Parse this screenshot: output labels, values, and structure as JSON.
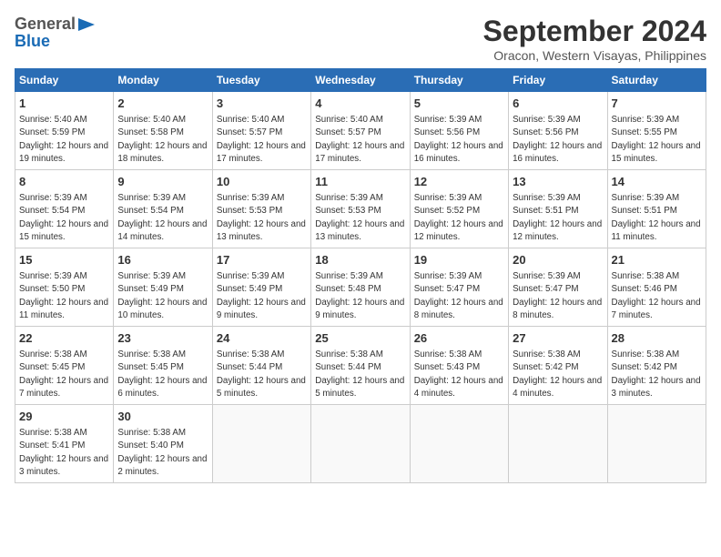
{
  "header": {
    "logo_general": "General",
    "logo_blue": "Blue",
    "month_title": "September 2024",
    "location": "Oracon, Western Visayas, Philippines"
  },
  "days_of_week": [
    "Sunday",
    "Monday",
    "Tuesday",
    "Wednesday",
    "Thursday",
    "Friday",
    "Saturday"
  ],
  "weeks": [
    [
      {
        "day": "1",
        "sunrise": "Sunrise: 5:40 AM",
        "sunset": "Sunset: 5:59 PM",
        "daylight": "Daylight: 12 hours and 19 minutes."
      },
      {
        "day": "2",
        "sunrise": "Sunrise: 5:40 AM",
        "sunset": "Sunset: 5:58 PM",
        "daylight": "Daylight: 12 hours and 18 minutes."
      },
      {
        "day": "3",
        "sunrise": "Sunrise: 5:40 AM",
        "sunset": "Sunset: 5:57 PM",
        "daylight": "Daylight: 12 hours and 17 minutes."
      },
      {
        "day": "4",
        "sunrise": "Sunrise: 5:40 AM",
        "sunset": "Sunset: 5:57 PM",
        "daylight": "Daylight: 12 hours and 17 minutes."
      },
      {
        "day": "5",
        "sunrise": "Sunrise: 5:39 AM",
        "sunset": "Sunset: 5:56 PM",
        "daylight": "Daylight: 12 hours and 16 minutes."
      },
      {
        "day": "6",
        "sunrise": "Sunrise: 5:39 AM",
        "sunset": "Sunset: 5:56 PM",
        "daylight": "Daylight: 12 hours and 16 minutes."
      },
      {
        "day": "7",
        "sunrise": "Sunrise: 5:39 AM",
        "sunset": "Sunset: 5:55 PM",
        "daylight": "Daylight: 12 hours and 15 minutes."
      }
    ],
    [
      {
        "day": "8",
        "sunrise": "Sunrise: 5:39 AM",
        "sunset": "Sunset: 5:54 PM",
        "daylight": "Daylight: 12 hours and 15 minutes."
      },
      {
        "day": "9",
        "sunrise": "Sunrise: 5:39 AM",
        "sunset": "Sunset: 5:54 PM",
        "daylight": "Daylight: 12 hours and 14 minutes."
      },
      {
        "day": "10",
        "sunrise": "Sunrise: 5:39 AM",
        "sunset": "Sunset: 5:53 PM",
        "daylight": "Daylight: 12 hours and 13 minutes."
      },
      {
        "day": "11",
        "sunrise": "Sunrise: 5:39 AM",
        "sunset": "Sunset: 5:53 PM",
        "daylight": "Daylight: 12 hours and 13 minutes."
      },
      {
        "day": "12",
        "sunrise": "Sunrise: 5:39 AM",
        "sunset": "Sunset: 5:52 PM",
        "daylight": "Daylight: 12 hours and 12 minutes."
      },
      {
        "day": "13",
        "sunrise": "Sunrise: 5:39 AM",
        "sunset": "Sunset: 5:51 PM",
        "daylight": "Daylight: 12 hours and 12 minutes."
      },
      {
        "day": "14",
        "sunrise": "Sunrise: 5:39 AM",
        "sunset": "Sunset: 5:51 PM",
        "daylight": "Daylight: 12 hours and 11 minutes."
      }
    ],
    [
      {
        "day": "15",
        "sunrise": "Sunrise: 5:39 AM",
        "sunset": "Sunset: 5:50 PM",
        "daylight": "Daylight: 12 hours and 11 minutes."
      },
      {
        "day": "16",
        "sunrise": "Sunrise: 5:39 AM",
        "sunset": "Sunset: 5:49 PM",
        "daylight": "Daylight: 12 hours and 10 minutes."
      },
      {
        "day": "17",
        "sunrise": "Sunrise: 5:39 AM",
        "sunset": "Sunset: 5:49 PM",
        "daylight": "Daylight: 12 hours and 9 minutes."
      },
      {
        "day": "18",
        "sunrise": "Sunrise: 5:39 AM",
        "sunset": "Sunset: 5:48 PM",
        "daylight": "Daylight: 12 hours and 9 minutes."
      },
      {
        "day": "19",
        "sunrise": "Sunrise: 5:39 AM",
        "sunset": "Sunset: 5:47 PM",
        "daylight": "Daylight: 12 hours and 8 minutes."
      },
      {
        "day": "20",
        "sunrise": "Sunrise: 5:39 AM",
        "sunset": "Sunset: 5:47 PM",
        "daylight": "Daylight: 12 hours and 8 minutes."
      },
      {
        "day": "21",
        "sunrise": "Sunrise: 5:38 AM",
        "sunset": "Sunset: 5:46 PM",
        "daylight": "Daylight: 12 hours and 7 minutes."
      }
    ],
    [
      {
        "day": "22",
        "sunrise": "Sunrise: 5:38 AM",
        "sunset": "Sunset: 5:45 PM",
        "daylight": "Daylight: 12 hours and 7 minutes."
      },
      {
        "day": "23",
        "sunrise": "Sunrise: 5:38 AM",
        "sunset": "Sunset: 5:45 PM",
        "daylight": "Daylight: 12 hours and 6 minutes."
      },
      {
        "day": "24",
        "sunrise": "Sunrise: 5:38 AM",
        "sunset": "Sunset: 5:44 PM",
        "daylight": "Daylight: 12 hours and 5 minutes."
      },
      {
        "day": "25",
        "sunrise": "Sunrise: 5:38 AM",
        "sunset": "Sunset: 5:44 PM",
        "daylight": "Daylight: 12 hours and 5 minutes."
      },
      {
        "day": "26",
        "sunrise": "Sunrise: 5:38 AM",
        "sunset": "Sunset: 5:43 PM",
        "daylight": "Daylight: 12 hours and 4 minutes."
      },
      {
        "day": "27",
        "sunrise": "Sunrise: 5:38 AM",
        "sunset": "Sunset: 5:42 PM",
        "daylight": "Daylight: 12 hours and 4 minutes."
      },
      {
        "day": "28",
        "sunrise": "Sunrise: 5:38 AM",
        "sunset": "Sunset: 5:42 PM",
        "daylight": "Daylight: 12 hours and 3 minutes."
      }
    ],
    [
      {
        "day": "29",
        "sunrise": "Sunrise: 5:38 AM",
        "sunset": "Sunset: 5:41 PM",
        "daylight": "Daylight: 12 hours and 3 minutes."
      },
      {
        "day": "30",
        "sunrise": "Sunrise: 5:38 AM",
        "sunset": "Sunset: 5:40 PM",
        "daylight": "Daylight: 12 hours and 2 minutes."
      },
      {
        "day": "",
        "sunrise": "",
        "sunset": "",
        "daylight": ""
      },
      {
        "day": "",
        "sunrise": "",
        "sunset": "",
        "daylight": ""
      },
      {
        "day": "",
        "sunrise": "",
        "sunset": "",
        "daylight": ""
      },
      {
        "day": "",
        "sunrise": "",
        "sunset": "",
        "daylight": ""
      },
      {
        "day": "",
        "sunrise": "",
        "sunset": "",
        "daylight": ""
      }
    ]
  ]
}
